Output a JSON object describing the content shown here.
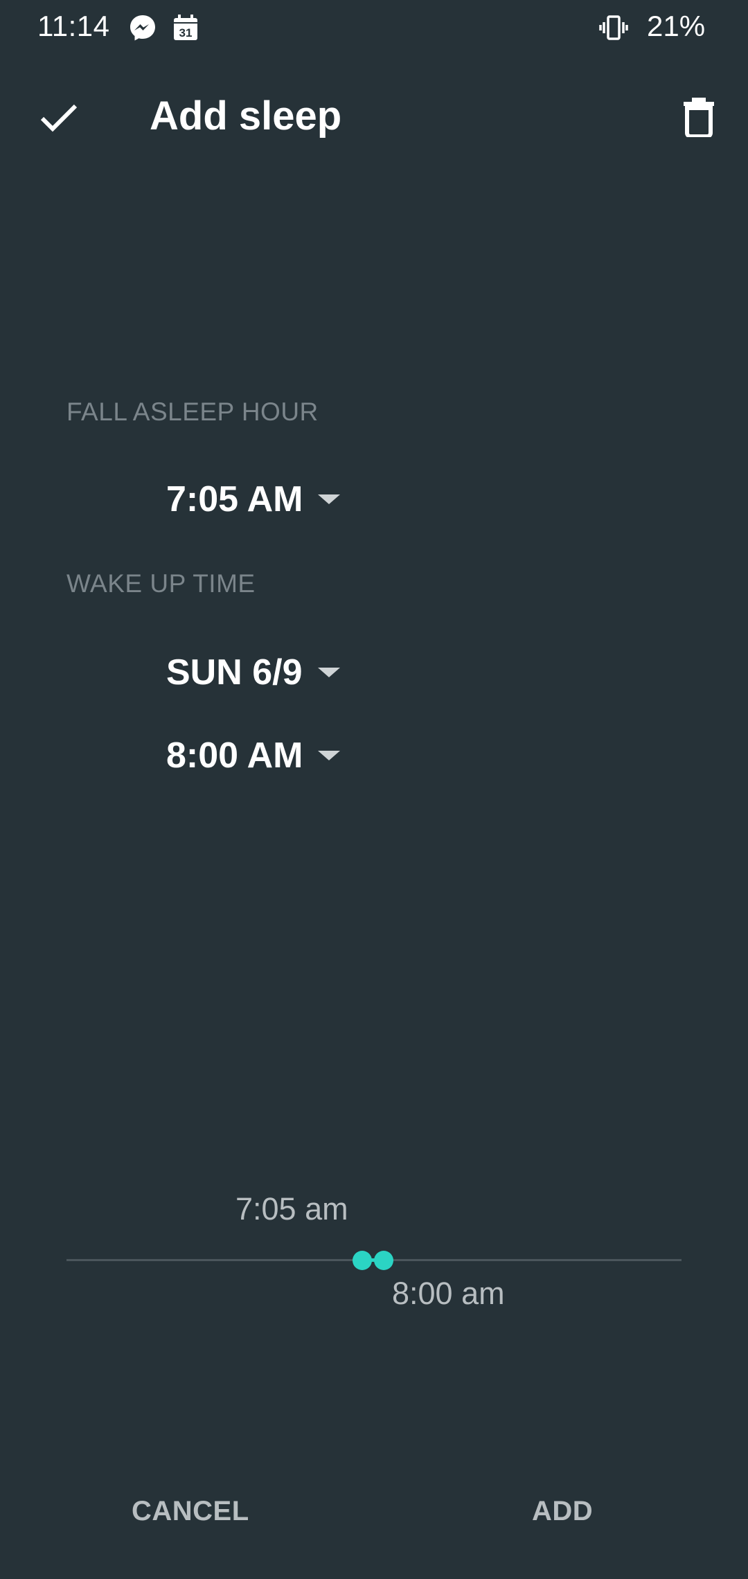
{
  "status_bar": {
    "time": "11:14",
    "calendar_day": "31",
    "battery": "21%",
    "icons": [
      "messenger-icon",
      "calendar-icon",
      "vibrate-icon"
    ]
  },
  "toolbar": {
    "title": "Add sleep",
    "confirm_icon": "check-icon",
    "delete_icon": "trash-icon"
  },
  "form": {
    "fall_asleep_label": "FALL ASLEEP HOUR",
    "fall_asleep_time": "7:05 AM",
    "wake_up_label": "WAKE UP TIME",
    "wake_up_date": "SUN 6/9",
    "wake_up_time": "8:00 AM"
  },
  "timeline": {
    "start_label": "7:05 am",
    "end_label": "8:00 am",
    "accent_color": "#2bd4c4"
  },
  "actions": {
    "cancel_label": "CANCEL",
    "add_label": "ADD"
  },
  "colors": {
    "background": "#263238",
    "label": "#7b858b",
    "accent": "#2bd4c4"
  }
}
